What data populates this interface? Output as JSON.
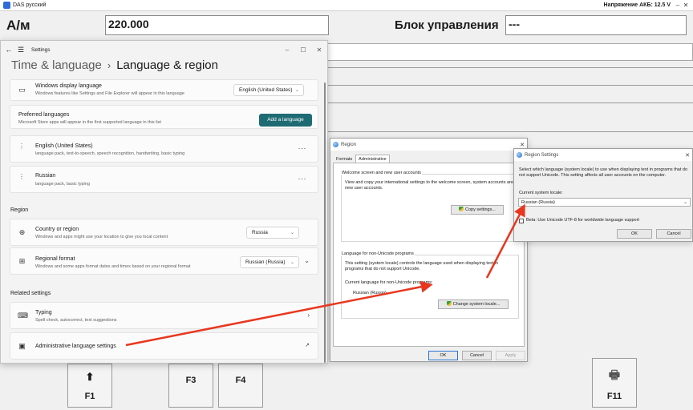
{
  "das": {
    "window_title": "DAS русский",
    "battery_voltage": "Напряжение АКБ: 12.5 V",
    "am_label": "А/м",
    "am_value": "220.000",
    "block_label": "Блок управления",
    "block_value": "---",
    "fkeys": [
      {
        "label": "F1",
        "icon": "up-arrow-icon"
      },
      {
        "label": "F3"
      },
      {
        "label": "F4"
      },
      {
        "label": "F11",
        "icon": "printer-icon"
      }
    ]
  },
  "settings": {
    "window_title": "Settings",
    "breadcrumb_parent": "Time & language",
    "breadcrumb_current": "Language & region",
    "display_language": {
      "title": "Windows display language",
      "subtitle": "Windows features like Settings and File Explorer will appear in this language",
      "value": "English (United States)"
    },
    "preferred": {
      "title": "Preferred languages",
      "subtitle": "Microsoft Store apps will appear in the first supported language in this list",
      "add_button": "Add a language"
    },
    "languages": [
      {
        "name": "English (United States)",
        "detail": "language pack, text-to-speech, speech recognition, handwriting, basic typing"
      },
      {
        "name": "Russian",
        "detail": "language pack, basic typing"
      }
    ],
    "region_heading": "Region",
    "country": {
      "title": "Country or region",
      "subtitle": "Windows and apps might use your location to give you local content",
      "value": "Russia"
    },
    "format": {
      "title": "Regional format",
      "subtitle": "Windows and some apps format dates and times based on your regional format",
      "value": "Russian (Russia)"
    },
    "related_heading": "Related settings",
    "typing": {
      "title": "Typing",
      "subtitle": "Spell check, autocorrect, text suggestions"
    },
    "admin": {
      "title": "Administrative language settings"
    }
  },
  "region_dialog": {
    "title": "Region",
    "tabs": [
      "Formats",
      "Administrative"
    ],
    "welcome_heading": "Welcome screen and new user accounts",
    "welcome_text": "View and copy your international settings to the welcome screen, system accounts and new user accounts.",
    "copy_button": "Copy settings...",
    "nonunicode_heading": "Language for non-Unicode programs",
    "nonunicode_text": "This setting (system locale) controls the language used when displaying text in programs that do not support Unicode.",
    "current_label": "Current language for non-Unicode programs:",
    "current_value": "Russian (Russia)",
    "change_button": "Change system locale...",
    "ok": "OK",
    "cancel": "Cancel",
    "apply": "Apply"
  },
  "region_settings": {
    "title": "Region Settings",
    "description": "Select which language (system locale) to use when displaying text in programs that do not support Unicode. This setting affects all user accounts on the computer.",
    "current_label": "Current system locale:",
    "current_value": "Russian (Russia)",
    "beta_label": "Beta: Use Unicode UTF-8 for worldwide language support",
    "ok": "OK",
    "cancel": "Cancel"
  },
  "colors": {
    "accent": "#1f6b73",
    "arrow": "#e8371f"
  }
}
